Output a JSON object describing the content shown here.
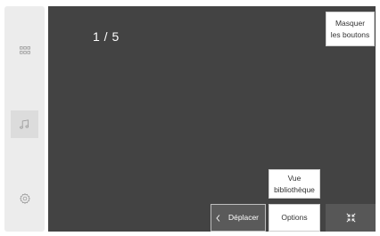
{
  "page_indicator": "1 / 5",
  "sidebar": {
    "items": [
      {
        "icon": "grid-icon"
      },
      {
        "icon": "music-note-icon"
      },
      {
        "icon": "gear-icon"
      }
    ]
  },
  "buttons": {
    "hide_line1": "Masquer",
    "hide_line2": "les boutons",
    "library_line1": "Vue",
    "library_line2": "bibliothèque",
    "move_label": "Déplacer",
    "options_label": "Options"
  },
  "colors": {
    "main_bg": "#434343",
    "sidebar_bg": "#ececec"
  }
}
